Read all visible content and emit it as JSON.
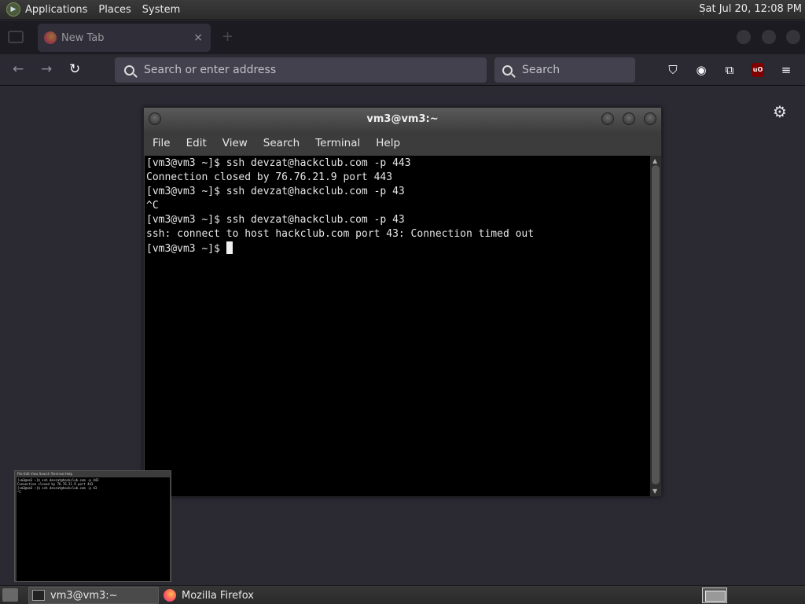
{
  "top_panel": {
    "menus": [
      "Applications",
      "Places",
      "System"
    ],
    "clock": "Sat Jul 20, 12:08 PM"
  },
  "browser": {
    "tab_title": "New Tab",
    "tab_close": "×",
    "url_placeholder": "Search or enter address",
    "search_placeholder": "Search",
    "icons": [
      "back-icon",
      "forward-icon",
      "reload-icon",
      "pocket-icon",
      "account-icon",
      "extensions-icon",
      "ublock-icon",
      "menu-icon",
      "settings-gear-icon"
    ],
    "ublock_label": "uO"
  },
  "terminal": {
    "title": "vm3@vm3:~",
    "menu": [
      "File",
      "Edit",
      "View",
      "Search",
      "Terminal",
      "Help"
    ],
    "lines": [
      "[vm3@vm3 ~]$ ssh devzat@hackclub.com -p 443",
      "Connection closed by 76.76.21.9 port 443",
      "[vm3@vm3 ~]$ ssh devzat@hackclub.com -p 43",
      "^C",
      "[vm3@vm3 ~]$ ssh devzat@hackclub.com -p 43",
      "ssh: connect to host hackclub.com port 43: Connection timed out"
    ],
    "prompt": "[vm3@vm3 ~]$ "
  },
  "preview": {
    "menu": "File  Edit  View  Search  Terminal  Help",
    "lines": "[vm3@vm3 ~]$ ssh devzat@hackclub.com -p 443\nConnection closed by 76.76.21.9 port 443\n[vm3@vm3 ~]$ ssh devzat@hackclub.com -p 43\n^C"
  },
  "taskbar": {
    "items": [
      "vm3@vm3:~",
      "Mozilla Firefox"
    ]
  }
}
